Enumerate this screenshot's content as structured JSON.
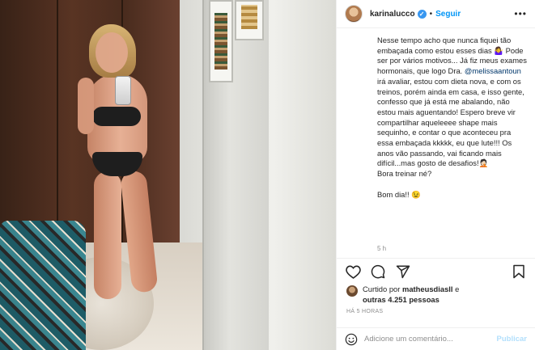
{
  "header": {
    "username": "karinalucco",
    "verified_mark": "✓",
    "separator": "•",
    "follow_label": "Seguir",
    "more_label": "•••"
  },
  "caption": {
    "p1": "Nesse tempo acho que nunca fiquei tão embaçada como estou esses dias 🤷‍♀️ Pode ser por vários motivos... Já fiz meus exames hormonais, que logo Dra. ",
    "mention": "@melissaantoun",
    "p2": " irá avaliar, estou com dieta nova, e com os treinos, porém ainda em casa, e isso gente, confesso que já está me abalando, não estou mais aguentando! Espero breve vir compartilhar aqueleeee shape mais sequinho, e contar o que aconteceu pra essa embaçada kkkkk, eu que lute!!! Os anos vão passando, vai ficando mais difícil...mas gosto de desafios!🤦🏻\nBora treinar né?\n\nBom dia!! 😉",
    "time": "5 h"
  },
  "likes": {
    "prefix": "Curtido por ",
    "user": "matheusdiasll",
    "middle": " e",
    "others": "outras 4.251 pessoas"
  },
  "date_label": "HÁ 5 HORAS",
  "comment": {
    "placeholder": "Adicione um comentário...",
    "post_label": "Publicar"
  },
  "icons": {
    "like": "heart-icon",
    "comment": "comment-icon",
    "share": "share-icon",
    "save": "bookmark-icon",
    "emoji": "smiley-icon"
  },
  "colors": {
    "link_blue": "#0095f6",
    "verified": "#3897f0",
    "muted": "#8e8e8e",
    "post_disabled": "#b2dffc"
  }
}
